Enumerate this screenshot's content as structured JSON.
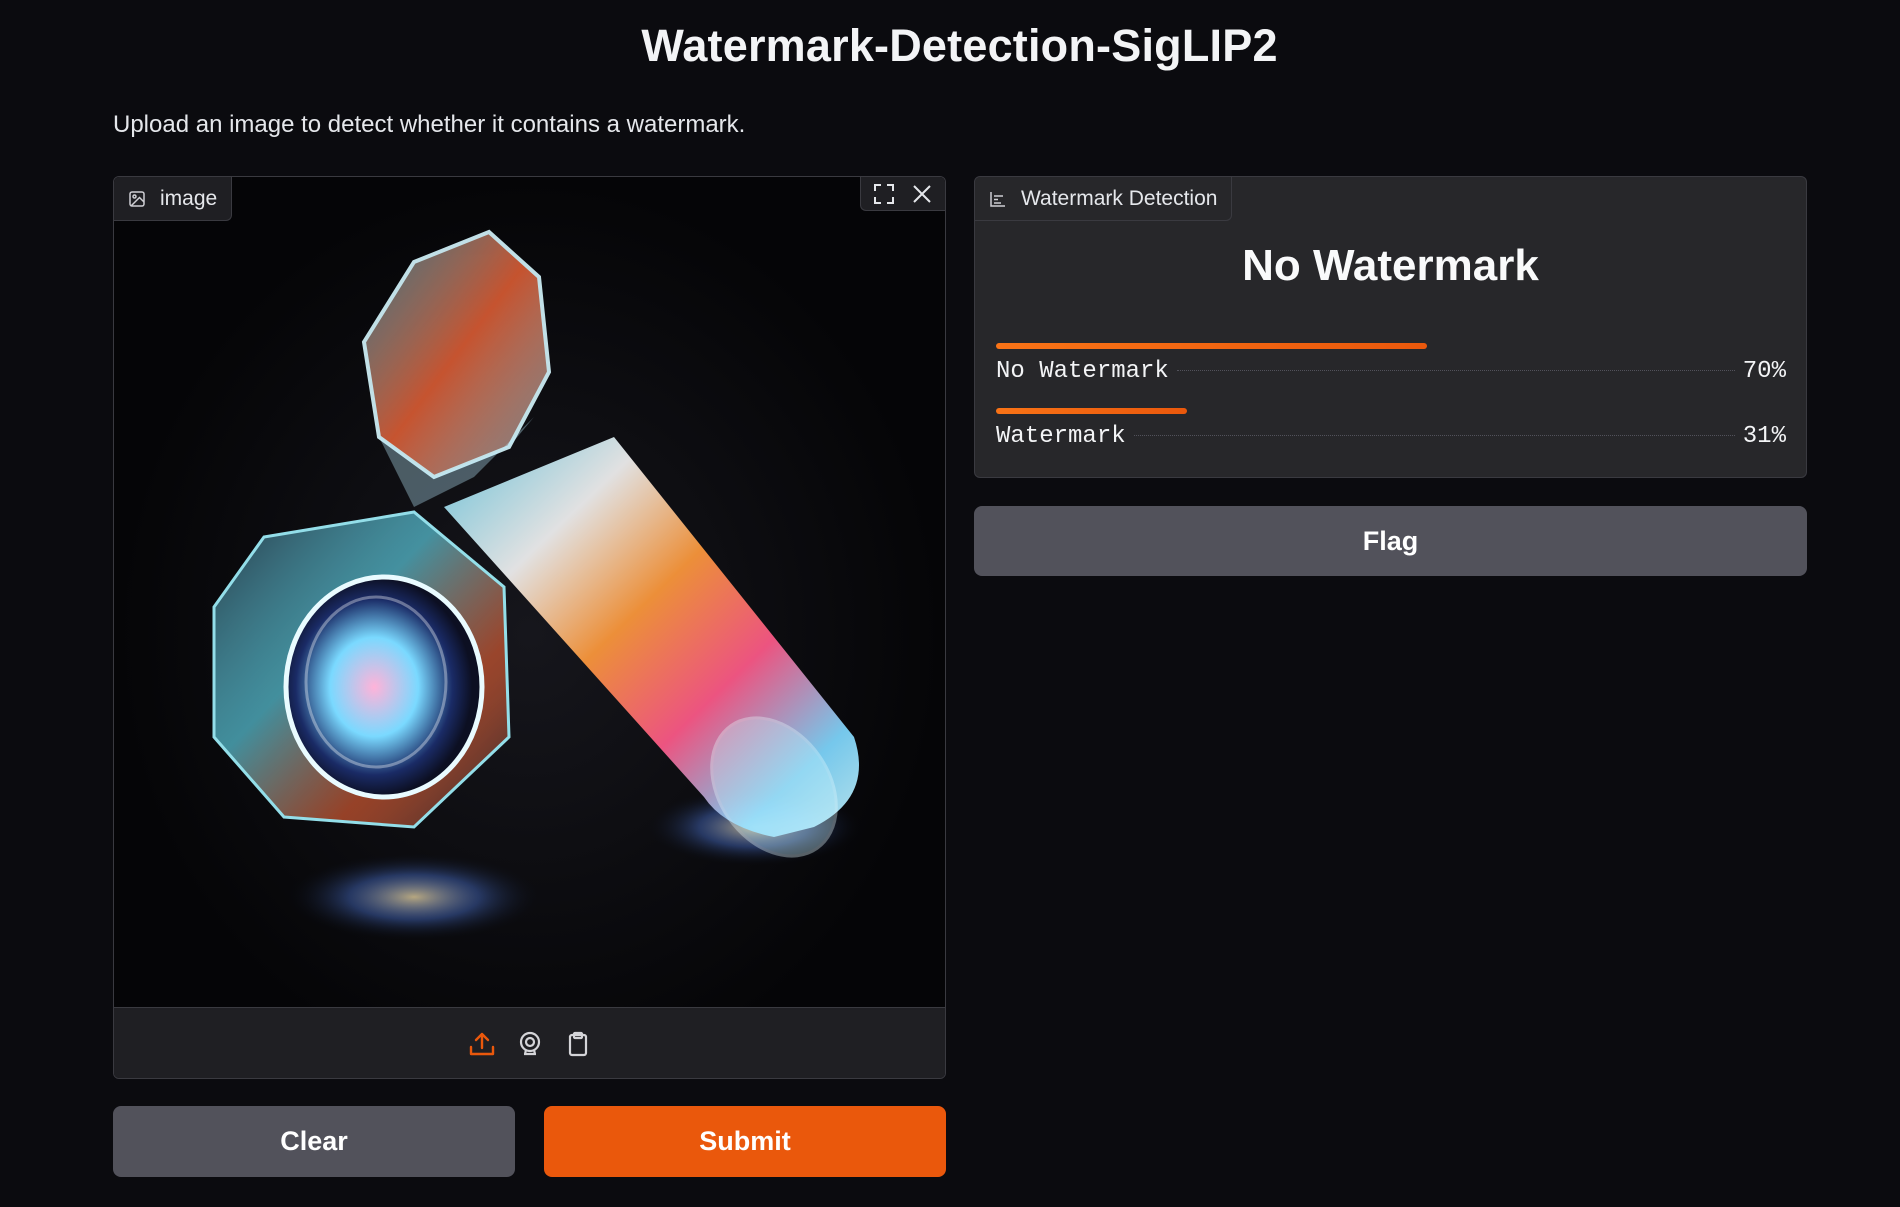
{
  "header": {
    "title": "Watermark-Detection-SigLIP2",
    "description": "Upload an image to detect whether it contains a watermark."
  },
  "input": {
    "label": "image",
    "label_icon": "image-icon",
    "tools": [
      "fullscreen-icon",
      "close-icon"
    ],
    "sources": [
      {
        "name": "upload-icon",
        "active": true
      },
      {
        "name": "webcam-icon",
        "active": false
      },
      {
        "name": "clipboard-icon",
        "active": false
      }
    ]
  },
  "buttons": {
    "clear": "Clear",
    "submit": "Submit",
    "flag": "Flag"
  },
  "output": {
    "label": "Watermark Detection",
    "label_icon": "bar-chart-icon",
    "predicted": "No Watermark",
    "confidences": [
      {
        "label": "No Watermark",
        "value": 0.7,
        "display": "70%"
      },
      {
        "label": "Watermark",
        "value": 0.31,
        "display": "31%"
      }
    ]
  },
  "colors": {
    "background": "#0b0b0f",
    "panel": "#27272a",
    "accent": "#ea580c",
    "secondary_button": "#52525b"
  }
}
